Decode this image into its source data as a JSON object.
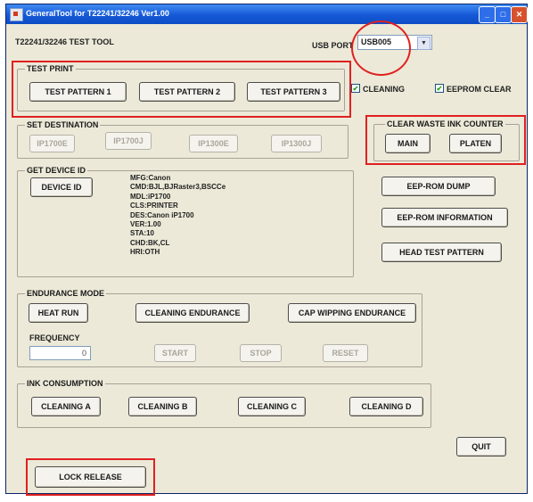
{
  "window": {
    "title": "GeneralTool for T22241/32246 Ver1.00",
    "min": "_",
    "max": "□",
    "close": "✕"
  },
  "tool_label": "T22241/32246 TEST TOOL",
  "usb": {
    "label": "USB PORT",
    "value": "USB005"
  },
  "test_print": {
    "title": "TEST PRINT",
    "buttons": [
      "TEST PATTERN 1",
      "TEST PATTERN 2",
      "TEST PATTERN 3"
    ]
  },
  "checks": [
    {
      "label": "CLEANING",
      "checked": true
    },
    {
      "label": "EEPROM CLEAR",
      "checked": true
    }
  ],
  "set_destination": {
    "title": "SET DESTINATION",
    "buttons": [
      "IP1700E",
      "IP1700J",
      "IP1300E",
      "IP1300J"
    ]
  },
  "clear_waste": {
    "title": "CLEAR WASTE INK COUNTER",
    "buttons": [
      "MAIN",
      "PLATEN"
    ]
  },
  "get_device": {
    "title": "GET DEVICE ID",
    "button": "DEVICE ID",
    "lines": [
      "MFG:Canon",
      "CMD:BJL,BJRaster3,BSCCe",
      "MDL:iP1700",
      "CLS:PRINTER",
      "DES:Canon iP1700",
      "VER:1.00",
      "STA:10",
      "CHD:BK,CL",
      "HRI:OTH"
    ]
  },
  "right_buttons": [
    "EEP-ROM DUMP",
    "EEP-ROM INFORMATION",
    "HEAD TEST PATTERN"
  ],
  "endurance": {
    "title": "ENDURANCE MODE",
    "buttons": [
      "HEAT RUN",
      "CLEANING ENDURANCE",
      "CAP WIPPING ENDURANCE"
    ],
    "frequency_label": "FREQUENCY",
    "frequency_value": "0",
    "start": "START",
    "stop": "STOP",
    "reset": "RESET"
  },
  "ink": {
    "title": "INK CONSUMPTION",
    "buttons": [
      "CLEANING A",
      "CLEANING B",
      "CLEANING C",
      "CLEANING D"
    ]
  },
  "quit": "QUIT",
  "lock_release": "LOCK RELEASE",
  "colors": {
    "highlight": "#e02020",
    "titlebar": "#1558d6",
    "face": "#ece9d8"
  }
}
